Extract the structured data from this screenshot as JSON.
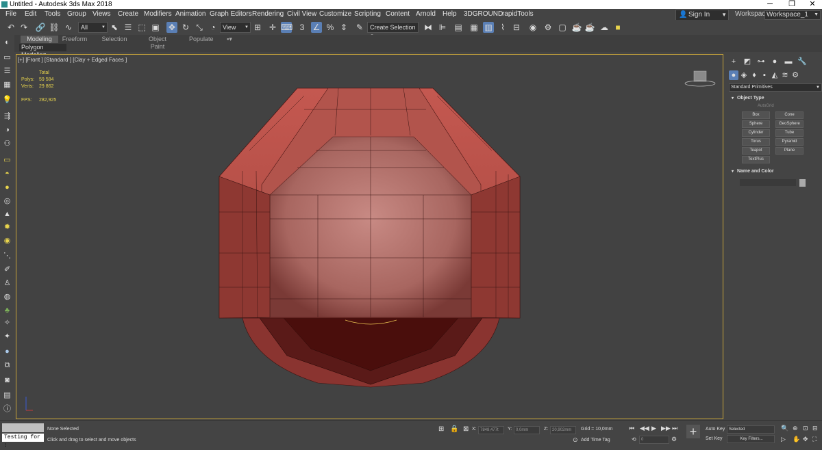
{
  "window": {
    "title": "Untitled - Autodesk 3ds Max 2018",
    "minimize": "─",
    "maximize": "❐",
    "close": "✕"
  },
  "menu": {
    "items": [
      "File",
      "Edit",
      "Tools",
      "Group",
      "Views",
      "Create",
      "Modifiers",
      "Animation",
      "Graph Editors",
      "Rendering",
      "Civil View",
      "Customize",
      "Scripting",
      "Content",
      "Arnold",
      "Help",
      "3DGROUND",
      "rapidTools"
    ],
    "sign_in": "Sign In",
    "workspaces_label": "Workspaces:",
    "workspace_value": "Workspace_1"
  },
  "toolbar": {
    "selection_filter": "All",
    "reference_coord": "View",
    "named_selection": "Create Selection Se",
    "icons": [
      "undo-icon",
      "redo-icon",
      "link-icon",
      "unlink-icon",
      "bind-space-warp-icon",
      "select-object-icon",
      "select-by-name-icon",
      "rect-select-region-icon",
      "window-crossing-icon",
      "select-and-move-icon",
      "select-and-rotate-icon",
      "select-and-scale-icon",
      "select-and-place-icon",
      "use-pivot-center-icon",
      "select-and-manipulate-icon",
      "keyboard-shortcut-override-icon",
      "snaps-toggle-icon",
      "angle-snap-icon",
      "percent-snap-icon",
      "spinner-snap-icon",
      "edit-named-selection-icon",
      "mirror-icon",
      "align-icon",
      "toggle-scene-explorer-icon",
      "toggle-layer-explorer-icon",
      "toggle-ribbon-icon",
      "curve-editor-icon",
      "schematic-view-icon",
      "material-editor-icon",
      "render-setup-icon",
      "rendered-frame-window-icon",
      "render-production-icon",
      "render-iterative-icon",
      "render-in-cloud-icon",
      "a360-gallery-icon"
    ]
  },
  "ribbon": {
    "tabs": [
      "Modeling",
      "Freeform",
      "Selection",
      "Object Paint",
      "Populate"
    ],
    "active_tab": "Modeling",
    "panel_label": "Polygon Modeling"
  },
  "viewport": {
    "label": "[+] [Front ] [Standard ] [Clay + Edged Faces ]",
    "stats": {
      "total_label": "Total",
      "polys_label": "Polys:",
      "polys_value": "59 584",
      "verts_label": "Verts:",
      "verts_value": "29 862",
      "fps_label": "FPS:",
      "fps_value": "282,925"
    }
  },
  "command_panel": {
    "tabs": [
      "create-tab",
      "modify-tab",
      "hierarchy-tab",
      "motion-tab",
      "display-tab",
      "utilities-tab"
    ],
    "subtabs": [
      "geometry-icon",
      "shapes-icon",
      "lights-icon",
      "cameras-icon",
      "helpers-icon",
      "space-warps-icon",
      "systems-icon"
    ],
    "category": "Standard Primitives",
    "object_type_title": "Object Type",
    "autogrid_label": "AutoGrid",
    "buttons": [
      "Box",
      "Cone",
      "Sphere",
      "GeoSphere",
      "Cylinder",
      "Tube",
      "Torus",
      "Pyramid",
      "Teapot",
      "Plane",
      "TextPlus"
    ],
    "name_color_title": "Name and Color",
    "object_color": "#aaaaaa"
  },
  "status": {
    "selection": "None Selected",
    "prompt": "Click and drag to select and move objects",
    "maxscript_input": "Testing for :",
    "x_label": "X:",
    "x_value": "7848,477t",
    "y_label": "Y:",
    "y_value": "0,0mm",
    "z_label": "Z:",
    "z_value": "20,902mm",
    "grid": "Grid = 10,0mm",
    "add_time_tag": "Add Time Tag",
    "frame": "0",
    "auto_key": "Auto Key",
    "set_key": "Set Key",
    "key_mode_selected": "Selected",
    "key_filters": "Key Filters..."
  },
  "colors": {
    "ui_dark": "#444444",
    "accent_blue": "#5a7fb5",
    "viewport_border": "#c9a53a",
    "stats_yellow": "#e8d44d",
    "model_red": "#b84a42"
  }
}
